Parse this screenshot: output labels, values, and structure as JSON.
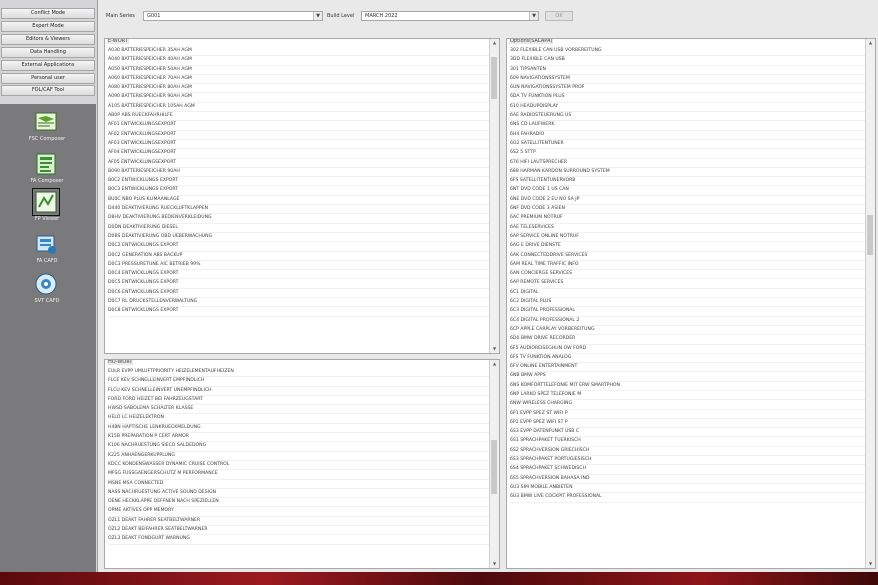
{
  "sidebar": {
    "menu": [
      "Conflict Mode",
      "Expert Mode",
      "Editors & Viewers",
      "Data Handling",
      "External Applications",
      "Personal user",
      "FDL/CAF Tool"
    ],
    "tools": [
      {
        "label": "FSC Composer",
        "icon": "fsc-composer-icon"
      },
      {
        "label": "FA Composer",
        "icon": "fa-composer-icon"
      },
      {
        "label": "FP Viewer",
        "icon": "fp-viewer-icon"
      },
      {
        "label": "FA CAFD",
        "icon": "fa-cafd-icon"
      },
      {
        "label": "SVT CAFD",
        "icon": "svt-cafd-icon"
      }
    ]
  },
  "topbar": {
    "main_series_label": "Main Series",
    "main_series_value": "G001",
    "build_level_label": "Build Level",
    "build_level_value": "MARCH 2022",
    "ok_label": "OK"
  },
  "panels": {
    "left_top": {
      "title": "E-WORT",
      "items": [
        "A030 BATTERIESPEICHER 35AH AGM",
        "A040 BATTERIESPEICHER 40AH AGM",
        "A050 BATTERIESPEICHER 50AH AGM",
        "A060 BATTERIESPEICHER 70AH AGM",
        "A080 BATTERIESPEICHER 80AH AGM",
        "A090 BATTERIESPEICHER 90AH AGM",
        "A105 BATTERIESPEICHER 105AH AGM",
        "AB0P ABS RUECKFAHRHILFE",
        "AF01 ENTWICKLUNGSEXPORT",
        "AF02 ENTWICKLUNGSEXPORT",
        "AF03 ENTWICKLUNGSEXPORT",
        "AF04 ENTWICKLUNGSEXPORT",
        "AF05 ENTWICKLUNGSEXPORT",
        "B090 BATTERIESPEICHER 90AH",
        "B0C2 ENTWICKLUNGS EXPORT",
        "B0C3 ENTWICKLUNGS EXPORT",
        "BU0C NBO PLUS KLIMAANLAGE",
        "D440 DEAKTIVIERUNG RUECKLUFTKLAPPEN",
        "D8HV DEAKTIVIERUNG BEDIENVERKLEIDUNG",
        "D0DN DEAKTIVIERUNG DIESEL",
        "D0BS DEAKTIVIERUNG OBD UEBERWACHUNG",
        "D0C2 ENTWICKLUNGS EXPORT",
        "D0C2 GENERATION ABS BACKUP",
        "D0C3 PRESSURETUNE AIC BETRIEB 99%",
        "D0C4 ENTWICKLUNGS EXPORT",
        "D0C5 ENTWICKLUNGS EXPORT",
        "D0C6 ENTWICKLUNGS EXPORT",
        "D0C7 RL DRUCKSTELLENVERWALTUNG",
        "D0C8 ENTWICKLUNGS EXPORT"
      ]
    },
    "left_bottom": {
      "title": "HO-WORT",
      "items": [
        "EULR EVPP UMLUFTPRIORITY HEIZELEMENTAUFHEIZEN",
        "FLCE KEV SCHNELLEINVERT EMPFINDLICH",
        "FLCU KEV SCHNELLEINVERT UNEMPFINDLICH",
        "FORD FORD HEIZET BEI FAHRZEUGSTART",
        "HWSD SABOLEMA SCHALTER KLASSE",
        "HELO LC HEIZELEKTRON",
        "H48N HAPTISCHE LENKRUECKMELDUNG",
        "K15B PREPARATION P CERT ARMOR",
        "K106 NACHRUESTUNG SIECO SALDEDONG",
        "K225 ANHAENGERKUPPLUNG",
        "KDCC KONDENSWASSER DYNAMIC CRUISE CONTROL",
        "MFSG FUSSGAENGERSCHUTZ M PERFORMANCE",
        "MSNE MSA CONNECTED",
        "NASS NACHRUESTUNG ACTIVE SOUND DESIGN",
        "OENE HECKKLAPPE OEFFNEN NACH SPEZIELLEN",
        "OPME AKTIVES OPP MEMORY",
        "OZL1 DEAKT FAHRER SEATBELTWARNER",
        "OZL2 DEAKT BEIFAHRER SEATBELTWARNER",
        "OZL3 DEAKT FONDGURT WARNUNG"
      ]
    },
    "right": {
      "title": "Options(SALAPA)",
      "items": [
        "302 FLEXIBLE CAN USB VORBEREITUNG",
        "3DD FLEXIBLE CAN USB",
        "301 TIPSANTEN",
        "609 NAVIGATIONSSYSTEM",
        "6UN NAVIGATIONSSYSTEM PROF",
        "6DA TV FUNKTION PLUS",
        "610 HEADUPDISPLAY",
        "6AE RADIOSTEUERUNG US",
        "6NS CD LAUFWERK",
        "6H4 FAHRADIO",
        "6O2 SATELLITENTUNER",
        "6S2 5 STTP",
        "676 HIFI LAUTSPRECHER",
        "688 HARMAN KARDON SURROUND SYSTEM",
        "6FS SATELLITENTUNERVORB",
        "6NT DVD CODE 1 US CAN",
        "6NE DVD CODE 2 EU NO SA JP",
        "6NF DVD CODE 3 ASIEN",
        "6AC PREMIUM NOTRUF",
        "6AE TELESERVICES",
        "6AP SERVICE ONLINE NOTRUF",
        "6AG E DRIVE DIENSTE",
        "6AK CONNECTEDDRIVE SERVICES",
        "6AM REAL TIME TRAFFIC INFO",
        "6AN CONCIERGE SERVICES",
        "6AP REMOTE SERVICES",
        "6C1 DIGITAL",
        "6C2 DIGITAL PLUS",
        "6C3 DIGITAL PROFESSIONAL",
        "6C4 DIGITAL PROFESSIONAL 2",
        "6CP APPLE CARPLAY VORBEREITUNG",
        "6D0 BMW DRIVE RECORDER",
        "6F5 AUDIOREISEGHUN OW FORD",
        "6FS TV FUNKTION ANALOG",
        "6FV ONLINE ENTERTAINMENT",
        "6NB BMW APPS",
        "6NS KOMFORTTELEFONIE MIT ERW SMARTPHON",
        "6NP LARKO SPEZ TELEFONIE M",
        "6NW WIRELESS CHARGING",
        "6P1 EVPP SPEZ ST WIFI P",
        "6P2 EVPP SPEZ WIFI ST P",
        "6S3 EVPP DATENFUNKT USB C",
        "6S1 SPRACHPAKET TUERKISCH",
        "6S2 SPRACHVERSION GRIECHISCH",
        "6S3 SPRACHPAKET PORTUGIESISCH",
        "6S4 SPRACHPAKET SCHWEDISCH",
        "6S5 SPRACHVERSION BAHASA IND",
        "6U3 SIM MOBILE ANBIETEN",
        "6U3 BMW LIVE COCKPIT PROFESSIONAL"
      ]
    }
  }
}
